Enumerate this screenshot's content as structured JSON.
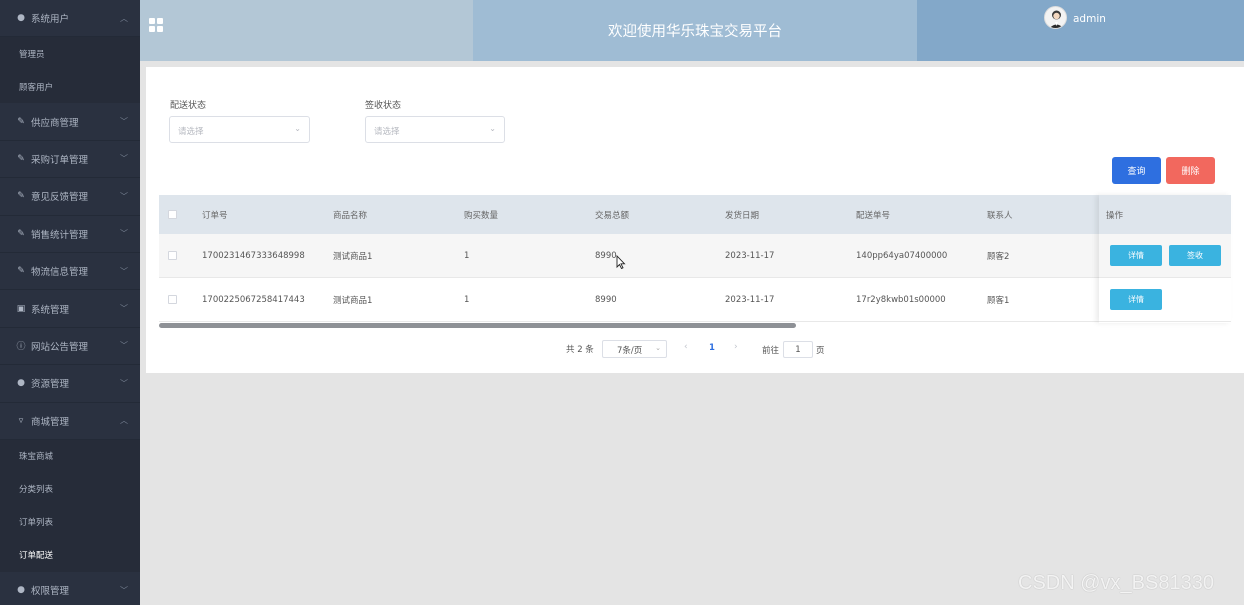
{
  "sidebar": {
    "items": [
      {
        "label": "系统用户",
        "icon": "user-icon",
        "expanded": true,
        "chevron": "︿"
      },
      {
        "label": "管理员",
        "sub": true
      },
      {
        "label": "顾客用户",
        "sub": true
      },
      {
        "label": "供应商管理",
        "icon": "edit-icon",
        "chevron": "﹀"
      },
      {
        "label": "采购订单管理",
        "icon": "edit-icon",
        "chevron": "﹀"
      },
      {
        "label": "意见反馈管理",
        "icon": "edit-icon",
        "chevron": "﹀"
      },
      {
        "label": "销售统计管理",
        "icon": "edit-icon",
        "chevron": "﹀"
      },
      {
        "label": "物流信息管理",
        "icon": "edit-icon",
        "chevron": "﹀"
      },
      {
        "label": "系统管理",
        "icon": "picture-icon",
        "chevron": "﹀"
      },
      {
        "label": "网站公告管理",
        "icon": "info-icon",
        "chevron": "﹀"
      },
      {
        "label": "资源管理",
        "icon": "location-icon",
        "chevron": "﹀"
      },
      {
        "label": "商城管理",
        "icon": "cart-icon",
        "expanded": true,
        "chevron": "︿"
      },
      {
        "label": "珠宝商城",
        "sub": true
      },
      {
        "label": "分类列表",
        "sub": true
      },
      {
        "label": "订单列表",
        "sub": true
      },
      {
        "label": "订单配送",
        "sub": true,
        "active": true
      },
      {
        "label": "权限管理",
        "icon": "user-icon",
        "chevron": "﹀"
      }
    ]
  },
  "header": {
    "title": "欢迎使用华乐珠宝交易平台",
    "username": "admin"
  },
  "filters": {
    "delivery_label": "配送状态",
    "delivery_placeholder": "请选择",
    "receipt_label": "签收状态",
    "receipt_placeholder": "请选择"
  },
  "buttons": {
    "query": "查询",
    "delete": "删除"
  },
  "table": {
    "columns": [
      "订单号",
      "商品名称",
      "购买数量",
      "交易总额",
      "发货日期",
      "配送单号",
      "联系人",
      "操作"
    ],
    "rows": [
      {
        "order_no": "1700231467333648998",
        "product": "测试商品1",
        "qty": "1",
        "total": "8990",
        "ship_date": "2023-11-17",
        "delivery_no": "140pp64ya07400000",
        "contact": "顾客2",
        "actions": [
          "详情",
          "签收"
        ]
      },
      {
        "order_no": "1700225067258417443",
        "product": "测试商品1",
        "qty": "1",
        "total": "8990",
        "ship_date": "2023-11-17",
        "delivery_no": "17r2y8kwb01s00000",
        "contact": "顾客1",
        "actions": [
          "详情"
        ]
      }
    ]
  },
  "pagination": {
    "total": "共 2 条",
    "page_size": "7条/页",
    "prev": "‹",
    "current": "1",
    "next": "›",
    "goto": "前往",
    "goto_value": "1",
    "unit": "页"
  },
  "watermark": "CSDN @vx_BS81330",
  "colors": {
    "sidebar_bg": "#2a3140",
    "header_left": "#b3c7d6",
    "header_mid": "#9fbcd4",
    "header_right": "#83a8c9",
    "query_btn": "#2e6fe0",
    "delete_btn": "#f2685e",
    "action_btn": "#3ab3e0"
  }
}
